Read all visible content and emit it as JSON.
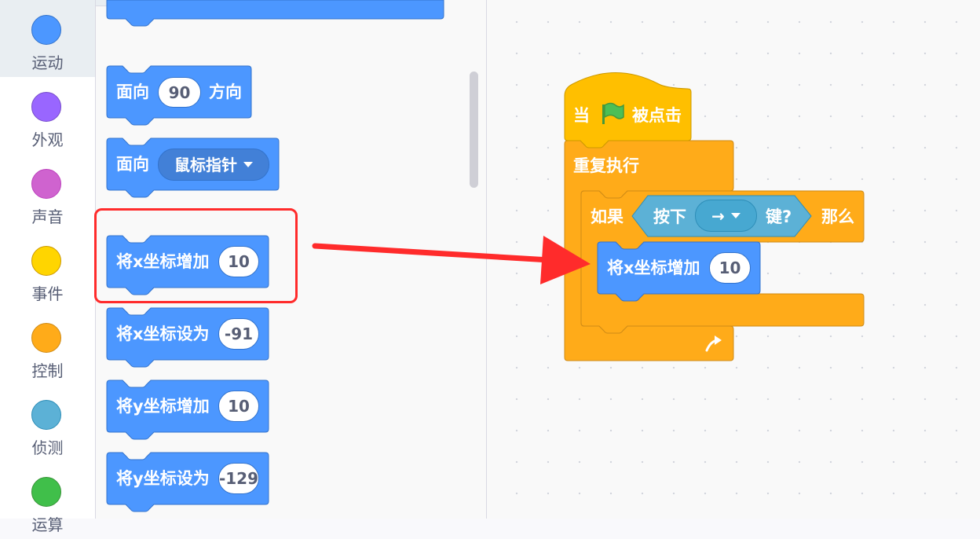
{
  "categories": [
    {
      "label": "运动",
      "color": "#4c97ff",
      "border": "#3373cc",
      "selected": true
    },
    {
      "label": "外观",
      "color": "#9966ff",
      "border": "#774dcb",
      "selected": false
    },
    {
      "label": "声音",
      "color": "#cf63cf",
      "border": "#bd42bd",
      "selected": false
    },
    {
      "label": "事件",
      "color": "#ffd500",
      "border": "#cc9900",
      "selected": false
    },
    {
      "label": "控制",
      "color": "#ffab19",
      "border": "#cf8b17",
      "selected": false
    },
    {
      "label": "侦测",
      "color": "#5cb1d6",
      "border": "#2e8eb8",
      "selected": false
    },
    {
      "label": "运算",
      "color": "#40bf4a",
      "border": "#389438",
      "selected": false
    }
  ],
  "palette": {
    "point_in_direction": {
      "label": "面向",
      "value": "90",
      "suffix": "方向"
    },
    "point_towards": {
      "label": "面向",
      "menu": "鼠标指针"
    },
    "change_x": {
      "label": "将x坐标增加",
      "value": "10"
    },
    "set_x": {
      "label": "将x坐标设为",
      "value": "-91"
    },
    "change_y": {
      "label": "将y坐标增加",
      "value": "10"
    },
    "set_y": {
      "label": "将y坐标设为",
      "value": "-129"
    }
  },
  "script": {
    "hat": {
      "label": "当",
      "suffix": "被点击",
      "flag_icon": "green-flag-icon"
    },
    "forever": {
      "label": "重复执行",
      "loop_icon": "loop-arrow-icon"
    },
    "if_block": {
      "label": "如果",
      "then": "那么"
    },
    "key_pressed": {
      "label": "按下",
      "key": "→",
      "suffix": "键?"
    },
    "inner": {
      "label": "将x坐标增加",
      "value": "10"
    }
  },
  "annotation": {
    "highlight_color": "#ff2b2b",
    "arrow_color": "#ff2b2b"
  },
  "colors": {
    "motion": "#4c97ff",
    "motion_dark": "#3373cc",
    "control": "#ffab19",
    "control_dark": "#cf8b17",
    "events": "#ffbf00",
    "events_dark": "#cc9900",
    "sensing": "#5cb1d6",
    "sensing_dark": "#2e8eb8"
  }
}
